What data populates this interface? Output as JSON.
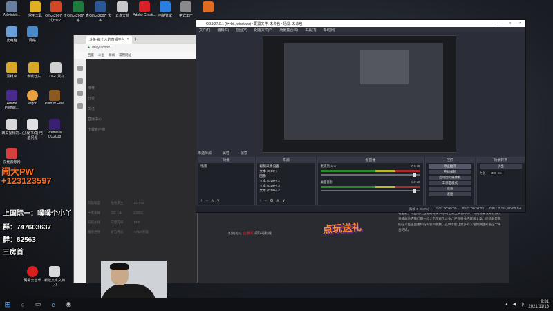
{
  "desktop": {
    "top_icons": [
      {
        "label": "Administr...",
        "color": "#6a7fa0"
      },
      {
        "label": "常用工具",
        "color": "#e0b020"
      },
      {
        "label": "Office2007_正式开PPT",
        "color": "#d24726"
      },
      {
        "label": "Office2007_表格",
        "color": "#1f7a3e"
      },
      {
        "label": "Office2007_文字",
        "color": "#2b5797"
      },
      {
        "label": "云盘文档",
        "color": "#c8c8c8"
      },
      {
        "label": "Adobe Creati...",
        "color": "#da1f26"
      },
      {
        "label": "电脑管家",
        "color": "#2a7fe0"
      },
      {
        "label": "格式工厂",
        "color": "#8a8a8a"
      },
      {
        "label": "",
        "color": "#e06a20"
      }
    ],
    "left_icons": [
      {
        "label": "此电脑",
        "color": "#6aa0d8"
      },
      {
        "label": "网络",
        "color": "#4a88c8"
      },
      {
        "label": "素材库",
        "color": "#d8a828"
      },
      {
        "label": "水城壮头",
        "color": "#d8a828"
      },
      {
        "label": "LOGO素材",
        "color": "#d0d0d0"
      },
      {
        "label": "Adobe Premie...",
        "color": "#4a2a8a"
      },
      {
        "label": "letgod",
        "color": "#e8a040"
      },
      {
        "label": "Path of Exile",
        "color": "#8a5a20"
      },
      {
        "label": "西瓜视频的...",
        "color": "#d8d8d8"
      },
      {
        "label": "(小秘书说) 电脑问题",
        "color": "#e0e0e0"
      },
      {
        "label": "Premiere CC2018",
        "color": "#3a2070"
      },
      {
        "label": "汉化去除网",
        "color": "#d84040"
      },
      {
        "label": "网易云音乐",
        "color": "#d82020"
      },
      {
        "label": "新建文本文档 (2)",
        "color": "#d8d8d8"
      }
    ]
  },
  "overlay": {
    "name": "闹大PW",
    "phone": "+123123597",
    "line1": "上国际一：噗噗个小丫",
    "line2": "群：747603637",
    "line3": "群：82563",
    "line4": "三房首"
  },
  "browser": {
    "tab_title": "斗鱼-每个人的直播平台",
    "address": "douyu.com/...",
    "bookmarks": [
      "百度",
      "斗鱼",
      "新闻",
      "常用网址"
    ],
    "menu": [
      "推荐",
      "分类",
      "关注",
      "直播中心",
      "下载客户端"
    ],
    "grid": [
      "英雄联盟",
      "绝地求生",
      "DOTA2",
      "王者荣耀",
      "QQ飞车",
      "CSGO",
      "穿越火线",
      "守望先锋",
      "DNF",
      "魔兽世界",
      "炉石传说",
      "APEX英雄"
    ]
  },
  "page": {
    "gift": "点玩送礼",
    "note_prefix": "如何可以",
    "note_link": "直播间",
    "note_suffix": "领取福利哦",
    "article": "有主机，斗鱼可以直播的每天24小时全天全天都不停，有内容要发布在做大直播的地方我们都一起，不仅有了斗鱼，还有很多内容和文章，这些就是我们在斗鱼里面更好的内容和视频，这样才能让更多的人看到并且知道这个平台的好。"
  },
  "obs": {
    "title": "OBS 27.0.1 (64-bit, windows) - 配置文件: 未命名 - 场景: 未命名",
    "menu": [
      "文件(F)",
      "编辑(E)",
      "视图(V)",
      "配置文件(P)",
      "场景集合(S)",
      "工具(T)",
      "帮助(H)"
    ],
    "no_source": "未选择源",
    "props": "属性",
    "filters": "滤镜",
    "docks": {
      "scenes": "场景",
      "sources": "来源",
      "mixer": "混音器",
      "transitions": "场景转换",
      "controls": "控件"
    },
    "scene_items": [
      "场景"
    ],
    "source_items": [
      "视频采集设备",
      "文本 (GDI+)",
      "图像",
      "文本 (GDI+) 2",
      "文本 (GDI+) 3",
      "文本 (GDI+) 4"
    ],
    "mixer_items": [
      {
        "name": "麦克风/Aux",
        "db": "0.0 dB"
      },
      {
        "name": "桌面音频",
        "db": "0.0 dB"
      }
    ],
    "transition_type": "淡出",
    "transition_duration_label": "时长",
    "transition_duration": "300 ms",
    "controls": [
      "停止推流",
      "开始录制",
      "启动虚拟摄像机",
      "工作室模式",
      "设置",
      "退出"
    ],
    "status": {
      "dropped": "丢帧 0 (0.0%)",
      "live": "LIVE: 00:00:00",
      "rec": "REC: 00:00:00",
      "cpu": "CPU: 2.1%, 60.00 fps"
    }
  },
  "taskbar": {
    "time": "9:31",
    "date": "2021/11/16",
    "lang": "中"
  }
}
